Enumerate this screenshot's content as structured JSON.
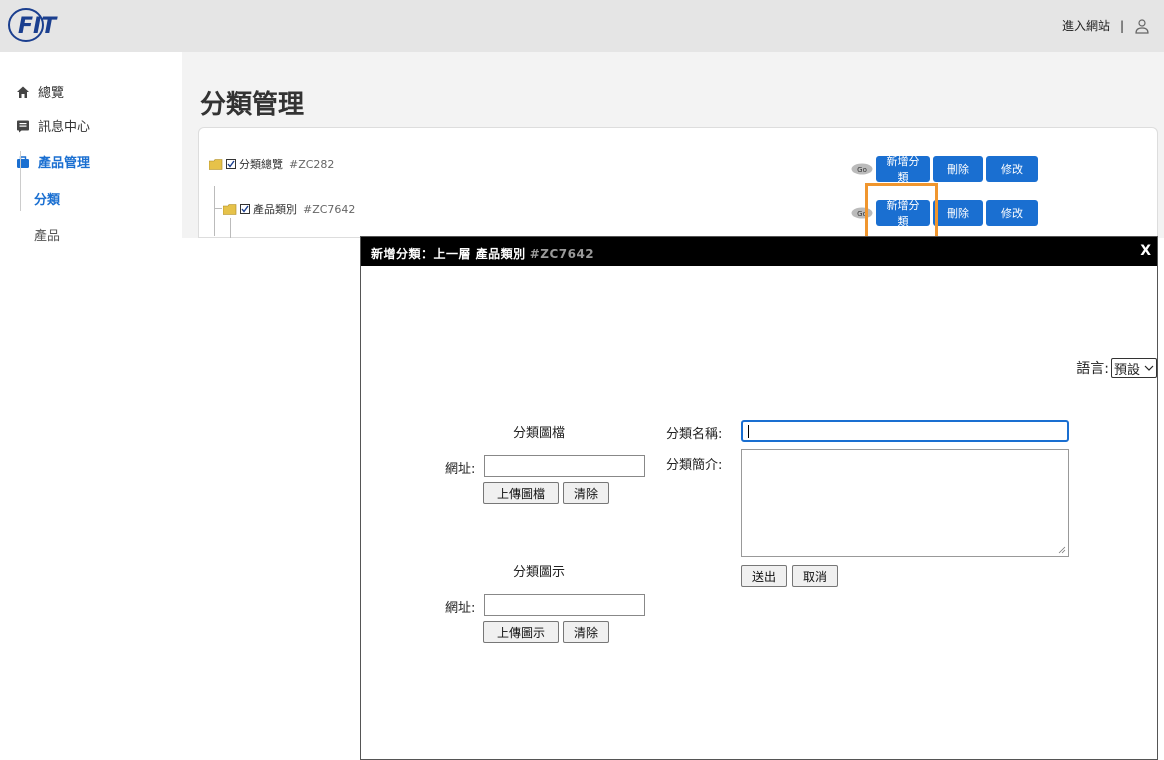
{
  "header": {
    "logo_text": "FIT",
    "enter_site": "進入網站",
    "separator": "|"
  },
  "sidebar": {
    "items": [
      {
        "label": "總覽",
        "icon": "home-icon"
      },
      {
        "label": "訊息中心",
        "icon": "message-icon"
      },
      {
        "label": "產品管理",
        "icon": "briefcase-icon",
        "active": true
      }
    ],
    "sub_items": [
      {
        "label": "分類",
        "active": true
      },
      {
        "label": "產品"
      }
    ]
  },
  "main": {
    "title": "分類管理",
    "tree": [
      {
        "label": "分類總覽",
        "code": "#ZC282"
      },
      {
        "label": "產品類別",
        "code": "#ZC7642"
      }
    ],
    "buttons": {
      "add": "新增分類",
      "delete": "刪除",
      "edit": "修改",
      "eye_badge": "Go"
    }
  },
  "modal": {
    "title_prefix": "新增分類：上一層 產品類別",
    "title_code": "#ZC7642",
    "close": "X",
    "language_label": "語言:",
    "language_value": "預設",
    "image_section": "分類圖檔",
    "icon_section": "分類圖示",
    "url_label": "網址:",
    "upload_image": "上傳圖檔",
    "upload_icon": "上傳圖示",
    "clear": "清除",
    "name_label": "分類名稱:",
    "intro_label": "分類簡介:",
    "submit": "送出",
    "cancel": "取消"
  },
  "colors": {
    "accent": "#1a6fd1",
    "highlight": "#f0962e",
    "topbar": "#e5e5e5"
  }
}
